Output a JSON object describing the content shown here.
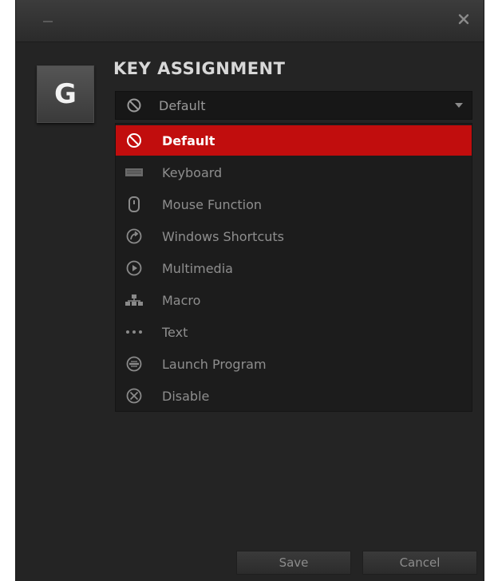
{
  "window": {
    "close_glyph": "×"
  },
  "key": {
    "letter": "G"
  },
  "section": {
    "title": "KEY ASSIGNMENT"
  },
  "select": {
    "value": "Default",
    "icon": "prohibited-icon",
    "chevron_icon": "chevron-down-icon"
  },
  "options": [
    {
      "label": "Default",
      "icon": "prohibited-icon",
      "selected": true
    },
    {
      "label": "Keyboard",
      "icon": "keyboard-icon",
      "selected": false
    },
    {
      "label": "Mouse Function",
      "icon": "mouse-icon",
      "selected": false
    },
    {
      "label": "Windows Shortcuts",
      "icon": "shortcut-arrow-icon",
      "selected": false
    },
    {
      "label": "Multimedia",
      "icon": "play-icon",
      "selected": false
    },
    {
      "label": "Macro",
      "icon": "macro-icon",
      "selected": false
    },
    {
      "label": "Text",
      "icon": "ellipsis-icon",
      "selected": false
    },
    {
      "label": "Launch Program",
      "icon": "launch-program-icon",
      "selected": false
    },
    {
      "label": "Disable",
      "icon": "disable-icon",
      "selected": false
    }
  ],
  "buttons": {
    "save_label": "Save",
    "cancel_label": "Cancel"
  },
  "colors": {
    "accent_red": "#c10d0d",
    "window_bg": "#242424",
    "text_dim": "#8e8e8e"
  }
}
